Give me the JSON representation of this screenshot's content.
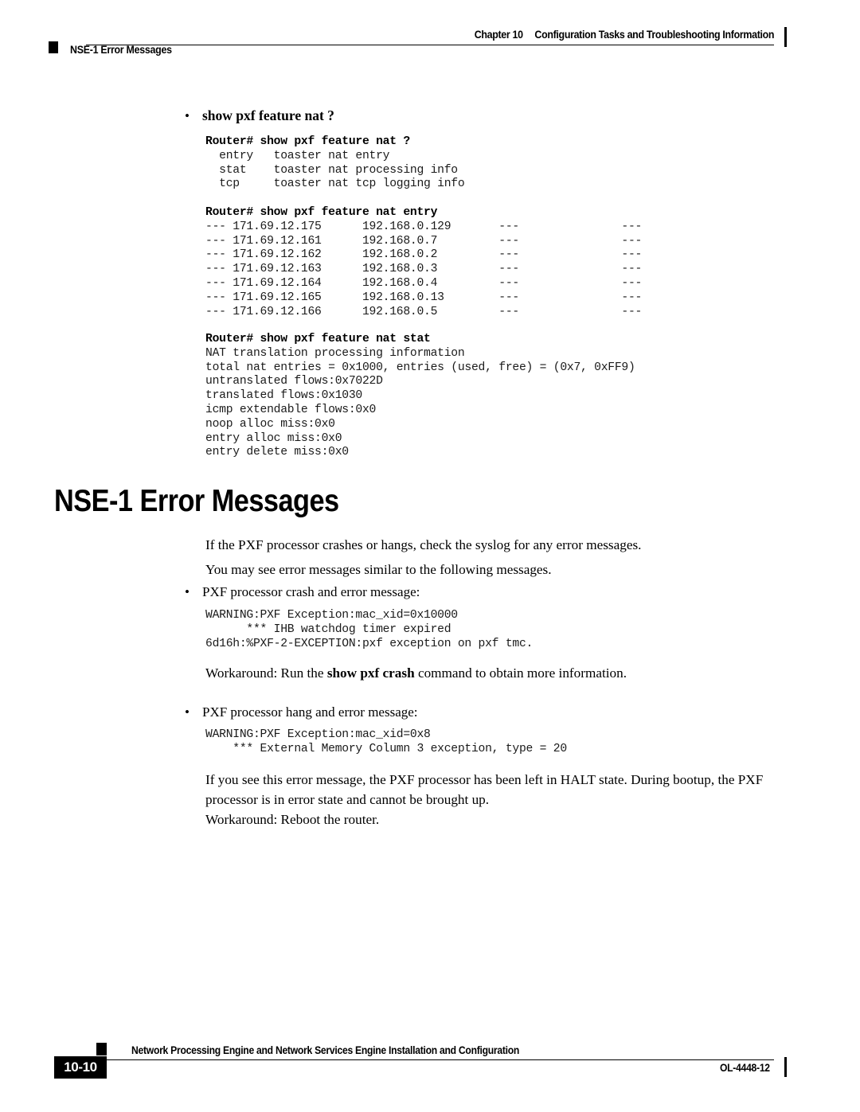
{
  "header": {
    "chapter_label": "Chapter 10",
    "chapter_title": "Configuration Tasks and Troubleshooting Information",
    "section_label": "NSE-1 Error Messages"
  },
  "body": {
    "bullet_command": "show pxf feature nat ?",
    "code_block_help": "Router# show pxf feature nat ?\n  entry   toaster nat entry\n  stat    toaster nat processing info\n  tcp     toaster nat tcp logging info",
    "code_block_help_cmd_prompt": "Router# ",
    "code_block_help_cmd": "show pxf feature nat ?",
    "code_block_help_lines": [
      "  entry   toaster nat entry",
      "  stat    toaster nat processing info",
      "  tcp     toaster nat tcp logging info"
    ],
    "code_block_entry_cmd_prompt": "Router# ",
    "code_block_entry_cmd": "show pxf feature nat entry",
    "code_block_entry_lines": [
      "--- 171.69.12.175      192.168.0.129       ---               ---",
      "--- 171.69.12.161      192.168.0.7         ---               ---",
      "--- 171.69.12.162      192.168.0.2         ---               ---",
      "--- 171.69.12.163      192.168.0.3         ---               ---",
      "--- 171.69.12.164      192.168.0.4         ---               ---",
      "--- 171.69.12.165      192.168.0.13        ---               ---",
      "--- 171.69.12.166      192.168.0.5         ---               ---"
    ],
    "code_block_stat_cmd_prompt": "Router# ",
    "code_block_stat_cmd": "show pxf feature nat stat",
    "code_block_stat_lines": [
      "NAT translation processing information",
      "total nat entries = 0x1000, entries (used, free) = (0x7, 0xFF9)",
      "untranslated flows:0x7022D",
      "translated flows:0x1030",
      "icmp extendable flows:0x0",
      "noop alloc miss:0x0",
      "entry alloc miss:0x0",
      "entry delete miss:0x0"
    ],
    "section_title": "NSE-1 Error Messages",
    "para_intro_1": "If the PXF processor crashes or hangs, check the syslog for any error messages.",
    "para_intro_2": "You may see error messages similar to the following messages.",
    "bullet_crash": "PXF processor crash and error message:",
    "code_block_crash": "WARNING:PXF Exception:mac_xid=0x10000\n      *** IHB watchdog timer expired\n6d16h:%PXF-2-EXCEPTION:pxf exception on pxf tmc.",
    "code_block_crash_lines": [
      "WARNING:PXF Exception:mac_xid=0x10000",
      "      *** IHB watchdog timer expired",
      "6d16h:%PXF-2-EXCEPTION:pxf exception on pxf tmc."
    ],
    "para_workaround_crash_pre": "Workaround: Run the ",
    "para_workaround_crash_bold": "show pxf crash",
    "para_workaround_crash_post": " command to obtain more information.",
    "bullet_hang": "PXF processor hang and error message:",
    "code_block_hang_lines": [
      "WARNING:PXF Exception:mac_xid=0x8",
      "    *** External Memory Column 3 exception, type = 20"
    ],
    "para_halt": "If you see this error message, the PXF processor has been left in HALT state. During bootup, the PXF processor is in error state and cannot be brought up.",
    "para_workaround_reboot": "Workaround: Reboot the router.",
    "bullet_glyph": "•"
  },
  "footer": {
    "doc_title": "Network Processing Engine and Network Services Engine Installation and Configuration",
    "page_number": "10-10",
    "doc_number": "OL-4448-12"
  }
}
